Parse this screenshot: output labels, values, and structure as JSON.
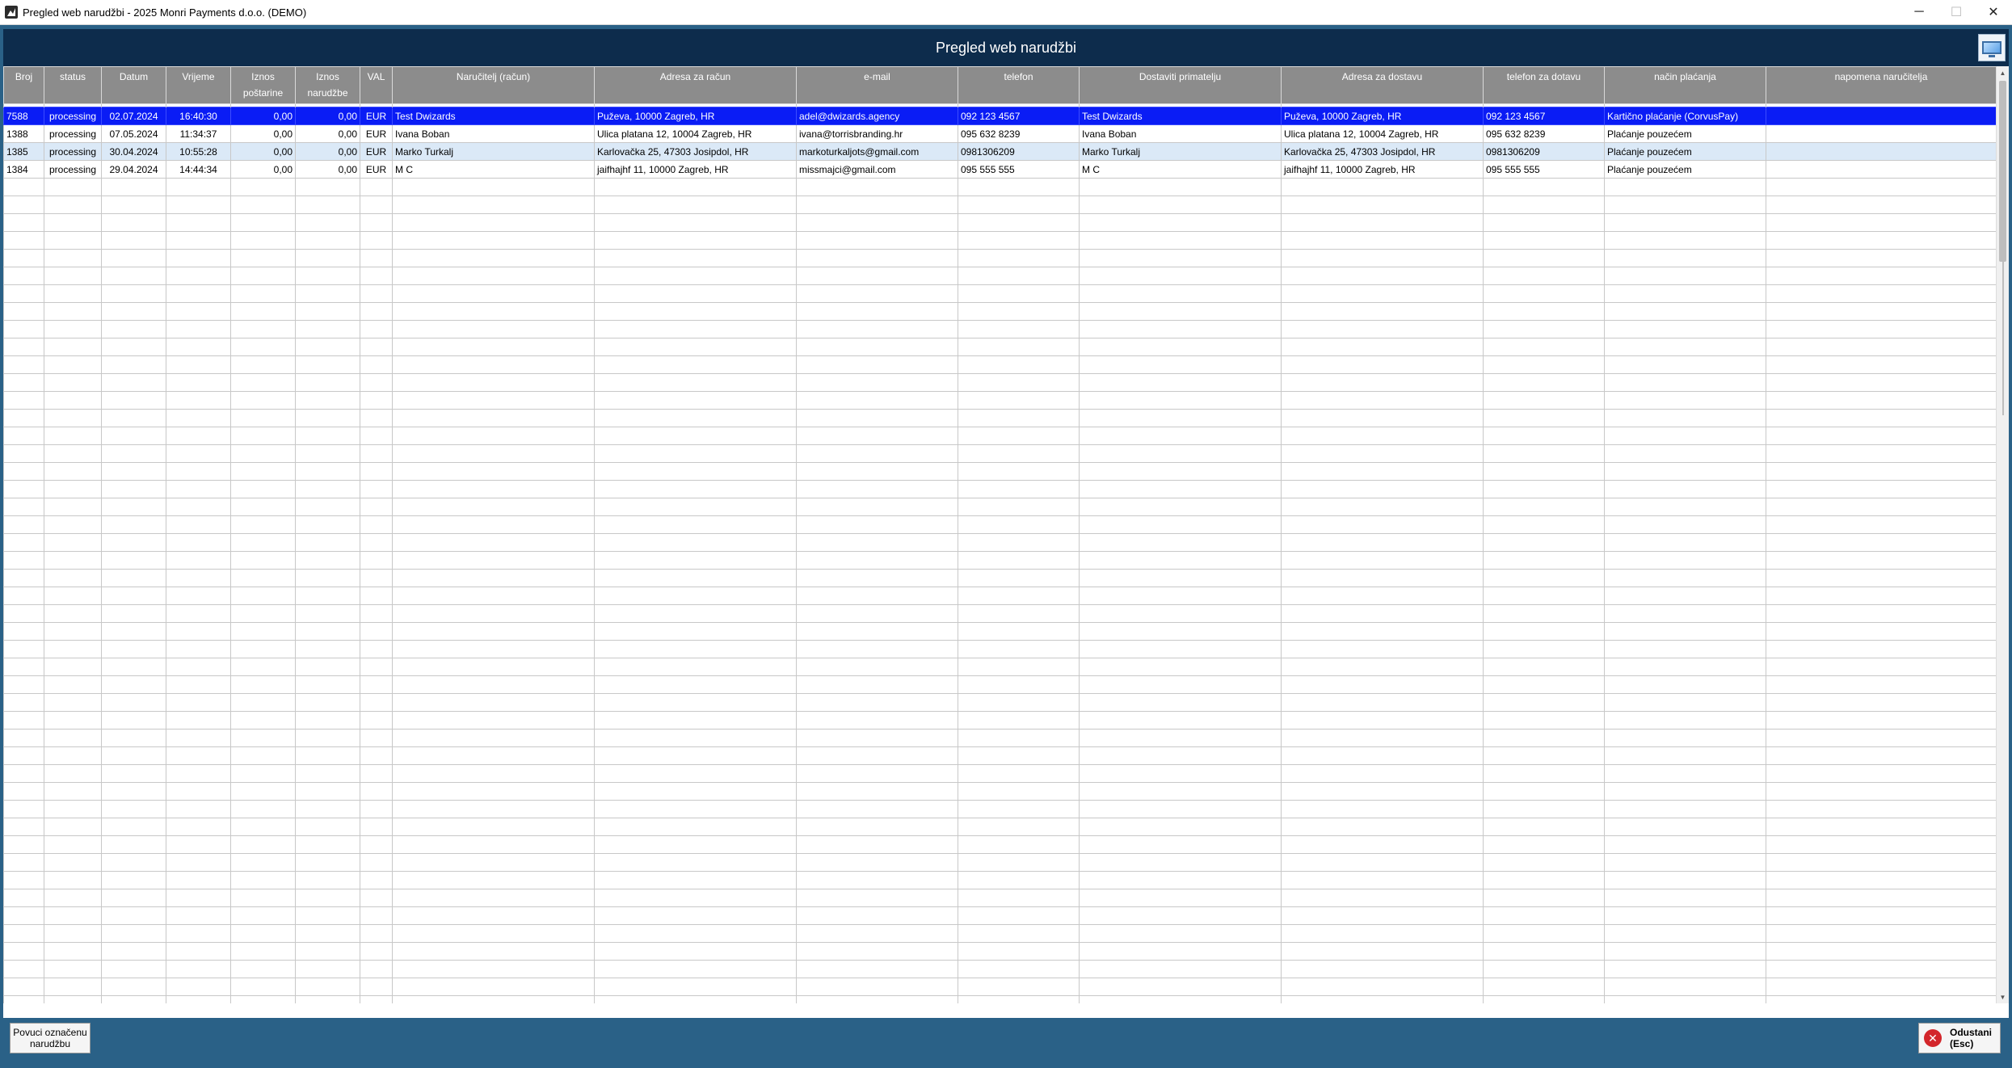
{
  "window": {
    "title": "Pregled web narudžbi - 2025 Monri Payments d.o.o. (DEMO)",
    "minimize_glyph": "─",
    "maximize_glyph": "☐",
    "close_glyph": "✕"
  },
  "header": {
    "title": "Pregled web narudžbi",
    "corner_icon": "monitor-icon"
  },
  "grid": {
    "columns": [
      {
        "label": "Broj"
      },
      {
        "label": "status"
      },
      {
        "label": "Datum"
      },
      {
        "label": "Vrijeme"
      },
      {
        "label": "Iznos poštarine"
      },
      {
        "label": "Iznos narudžbe"
      },
      {
        "label": "VAL"
      },
      {
        "label": "Naručitelj (račun)"
      },
      {
        "label": "Adresa za račun"
      },
      {
        "label": "e-mail"
      },
      {
        "label": "telefon"
      },
      {
        "label": "Dostaviti primatelju"
      },
      {
        "label": "Adresa za dostavu"
      },
      {
        "label": "telefon za dotavu"
      },
      {
        "label": "način plaćanja"
      },
      {
        "label": "napomena naručitelja"
      }
    ],
    "rows": [
      [
        "7588",
        "processing",
        "02.07.2024",
        "16:40:30",
        "0,00",
        "0,00",
        "EUR",
        "Test Dwizards",
        "Puževa, 10000 Zagreb,  HR",
        "adel@dwizards.agency",
        "092 123 4567",
        "Test Dwizards",
        "Puževa, 10000 Zagreb,  HR",
        "092 123 4567",
        "Kartično plaćanje (CorvusPay)",
        ""
      ],
      [
        "1388",
        "processing",
        "07.05.2024",
        "11:34:37",
        "0,00",
        "0,00",
        "EUR",
        "Ivana Boban",
        "Ulica platana 12, 10004 Zagreb,  HR",
        "ivana@torrisbranding.hr",
        "095 632 8239",
        "Ivana Boban",
        "Ulica platana 12, 10004 Zagreb,  HR",
        "095 632 8239",
        "Plaćanje pouzećem",
        ""
      ],
      [
        "1385",
        "processing",
        "30.04.2024",
        "10:55:28",
        "0,00",
        "0,00",
        "EUR",
        "Marko Turkalj",
        "Karlovačka 25, 47303 Josipdol,  HR",
        "markoturkaljots@gmail.com",
        "0981306209",
        "Marko Turkalj",
        "Karlovačka 25, 47303 Josipdol,  HR",
        "0981306209",
        "Plaćanje pouzećem",
        ""
      ],
      [
        "1384",
        "processing",
        "29.04.2024",
        "14:44:34",
        "0,00",
        "0,00",
        "EUR",
        "M C",
        "jaifhajhf 11, 10000 Zagreb,  HR",
        "missmajci@gmail.com",
        "095 555 555",
        "M C",
        "jaifhajhf 11, 10000 Zagreb,  HR",
        "095 555 555",
        "Plaćanje pouzećem",
        ""
      ]
    ],
    "selected_row_index": 0,
    "empty_row_count": 47
  },
  "toolbar": {
    "fetch_label_line1": "Povuci označenu",
    "fetch_label_line2": "narudžbu",
    "cancel_label_line1": "Odustani",
    "cancel_label_line2": "(Esc)",
    "cancel_glyph": "✕"
  },
  "colors": {
    "header_band": "#0d2c4c",
    "background": "#2a6187",
    "selected_row": "#0a1cf5",
    "alt_row": "#dbe9f7",
    "column_header": "#8c8c8c"
  }
}
